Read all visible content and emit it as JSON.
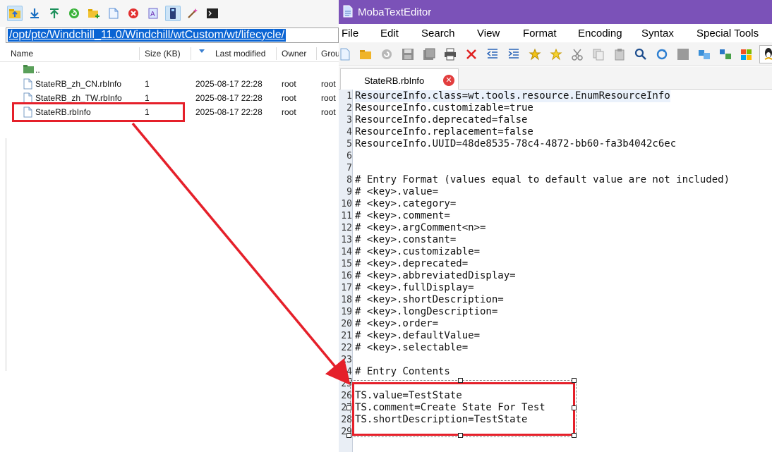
{
  "file_browser": {
    "path": "/opt/ptc/Windchill_11.0/Windchill/wtCustom/wt/lifecycle/",
    "columns": [
      "Name",
      "Size (KB)",
      "Last modified",
      "Owner",
      "Grou"
    ],
    "parent_dir": "..",
    "files": [
      {
        "name": "StateRB_zh_CN.rbInfo",
        "size": "1",
        "modified": "2025-08-17 22:28",
        "owner": "root",
        "group": "root"
      },
      {
        "name": "StateRB_zh_TW.rbInfo",
        "size": "1",
        "modified": "2025-08-17 22:28",
        "owner": "root",
        "group": "root"
      },
      {
        "name": "StateRB.rbInfo",
        "size": "1",
        "modified": "2025-08-17 22:28",
        "owner": "root",
        "group": "root"
      }
    ],
    "toolbar_icons": [
      "folder-up-icon",
      "download-icon",
      "upload-icon",
      "refresh-icon",
      "new-folder-icon",
      "new-file-icon",
      "delete-icon",
      "rename-icon",
      "terminal-follow-icon",
      "magic-wand-icon",
      "terminal-icon"
    ]
  },
  "editor": {
    "title": "MobaTextEditor",
    "menu": [
      "File",
      "Edit",
      "Search",
      "View",
      "Format",
      "Encoding",
      "Syntax",
      "Special Tools"
    ],
    "tab_label": "StateRB.rbInfo",
    "lines": [
      {
        "n": "1",
        "text": "ResourceInfo.class=wt.tools.resource.EnumResourceInfo"
      },
      {
        "n": "2",
        "text": "ResourceInfo.customizable=true"
      },
      {
        "n": "3",
        "text": "ResourceInfo.deprecated=false"
      },
      {
        "n": "4",
        "text": "ResourceInfo.replacement=false"
      },
      {
        "n": "5",
        "text": "ResourceInfo.UUID=48de8535-78c4-4872-bb60-fa3b4042c6ec"
      },
      {
        "n": "6",
        "text": ""
      },
      {
        "n": "7",
        "text": ""
      },
      {
        "n": "8",
        "text": "# Entry Format (values equal to default value are not included)"
      },
      {
        "n": "9",
        "text": "# <key>.value="
      },
      {
        "n": "10",
        "text": "# <key>.category="
      },
      {
        "n": "11",
        "text": "# <key>.comment="
      },
      {
        "n": "12",
        "text": "# <key>.argComment<n>="
      },
      {
        "n": "13",
        "text": "# <key>.constant="
      },
      {
        "n": "14",
        "text": "# <key>.customizable="
      },
      {
        "n": "15",
        "text": "# <key>.deprecated="
      },
      {
        "n": "16",
        "text": "# <key>.abbreviatedDisplay="
      },
      {
        "n": "17",
        "text": "# <key>.fullDisplay="
      },
      {
        "n": "18",
        "text": "# <key>.shortDescription="
      },
      {
        "n": "19",
        "text": "# <key>.longDescription="
      },
      {
        "n": "20",
        "text": "# <key>.order="
      },
      {
        "n": "21",
        "text": "# <key>.defaultValue="
      },
      {
        "n": "22",
        "text": "# <key>.selectable="
      },
      {
        "n": "23",
        "text": ""
      },
      {
        "n": "24",
        "text": "# Entry Contents"
      },
      {
        "n": "25",
        "text": ""
      },
      {
        "n": "26",
        "text": "TS.value=TestState"
      },
      {
        "n": "27",
        "text": "TS.comment=Create State For Test"
      },
      {
        "n": "28",
        "text": "TS.shortDescription=TestState"
      },
      {
        "n": "29",
        "text": ""
      }
    ]
  },
  "colors": {
    "title_bar": "#7b52b8",
    "path_highlight": "#0a64d3",
    "annotation_red": "#e5202a"
  }
}
